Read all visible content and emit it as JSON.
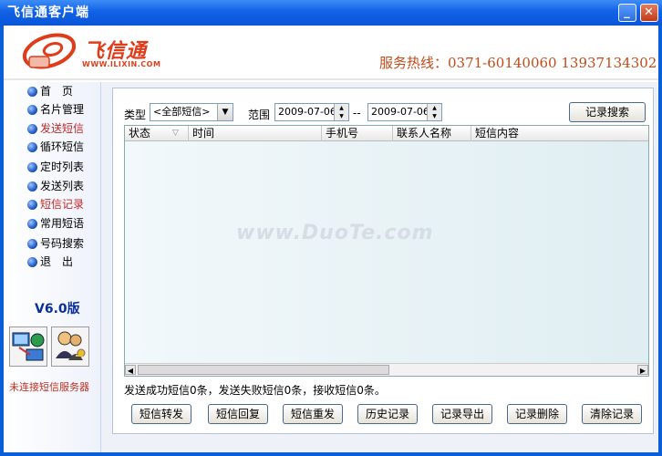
{
  "window": {
    "title": "飞信通客户端"
  },
  "header": {
    "logo_text": "飞信通",
    "logo_url": "WWW.ILIXIN.COM",
    "hotline": "服务热线：0371-60140060 13937134302"
  },
  "sidebar": {
    "items": [
      {
        "label": "首　页"
      },
      {
        "label": "名片管理"
      },
      {
        "label": "发送短信"
      },
      {
        "label": "循环短信"
      },
      {
        "label": "定时列表"
      },
      {
        "label": "发送列表"
      },
      {
        "label": "短信记录"
      },
      {
        "label": "常用短语"
      },
      {
        "label": "号码搜索"
      },
      {
        "label": "退　出"
      }
    ],
    "version": "V6.0版",
    "status": "未连接短信服务器"
  },
  "filters": {
    "type_label": "类型",
    "type_value": "<全部短信>",
    "range_label": "范围",
    "date_from": "2009-07-06",
    "range_sep": "--",
    "date_to": "2009-07-06",
    "search_button": "记录搜索"
  },
  "table": {
    "columns": [
      "状态",
      "时间",
      "手机号",
      "联系人名称",
      "短信内容"
    ],
    "rows": []
  },
  "summary": "发送成功短信0条，发送失败短信0条，接收短信0条。",
  "actions": [
    "短信转发",
    "短信回复",
    "短信重发",
    "历史记录",
    "记录导出",
    "记录删除",
    "清除记录"
  ],
  "watermark": "www.DuoTe.com"
}
